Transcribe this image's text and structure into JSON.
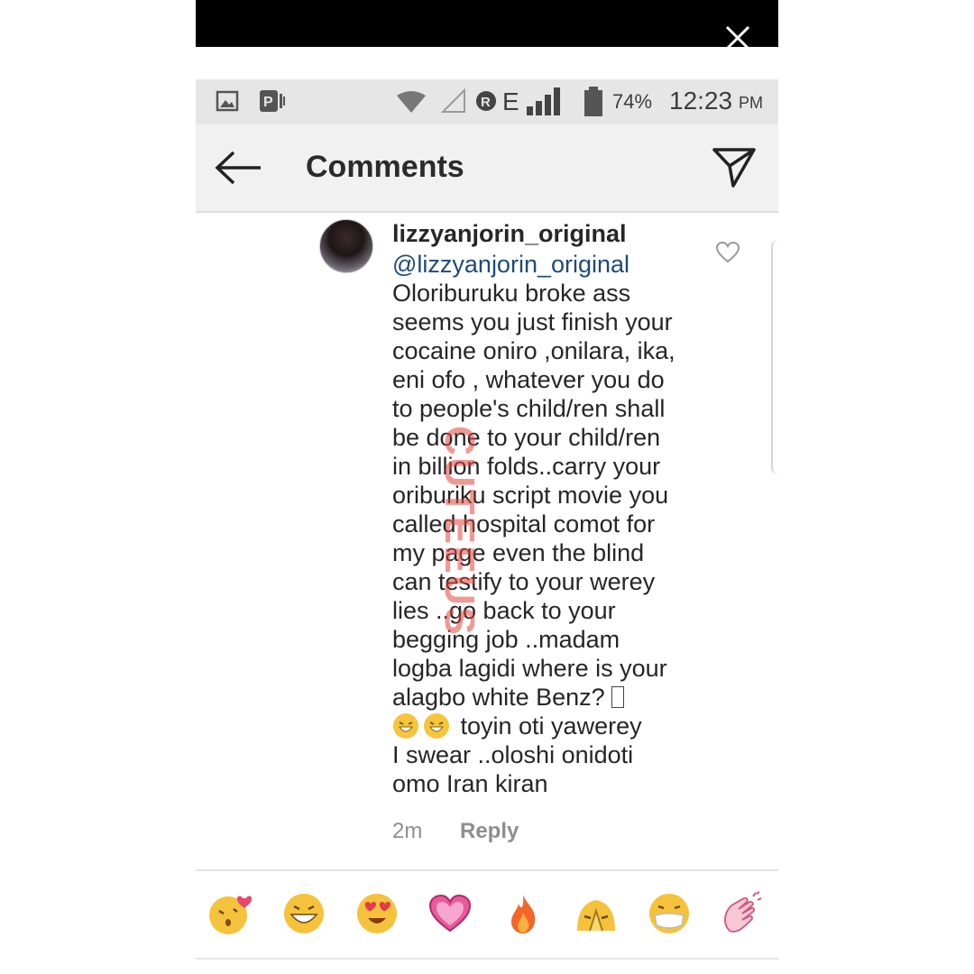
{
  "status_bar": {
    "battery": "74%",
    "time": "12:23",
    "ampm": "PM",
    "network": "E"
  },
  "header": {
    "title": "Comments"
  },
  "comment": {
    "username": "lizzyanjorin_original",
    "mention": "@lizzyanjorin_original",
    "lines": [
      "Oloriburuku broke ass",
      "seems you just finish your",
      "cocaine oniro ,onilara,  ika,",
      "eni ofo , whatever you do",
      "to people's child/ren shall",
      "be done to your child/ren",
      "in billion folds..carry your",
      "oriburiku script movie you",
      "called hospital comot for",
      "my page even the blind",
      "can testify to your werey",
      "lies ..go back to your",
      "begging job ..madam",
      "logba lagidi where is your",
      "alagbo white Benz? ",
      " toyin oti yawerey",
      "I swear ..oloshi onidoti",
      "omo Iran kiran"
    ],
    "time": "2m",
    "reply_label": "Reply"
  },
  "watermark": "CUTEEUS",
  "emoji_bar": [
    "kiss-emoji",
    "grin-emoji",
    "heart-eyes-emoji",
    "heart-emoji",
    "fire-emoji",
    "praying-emoji",
    "mask-emoji",
    "clap-emoji"
  ]
}
